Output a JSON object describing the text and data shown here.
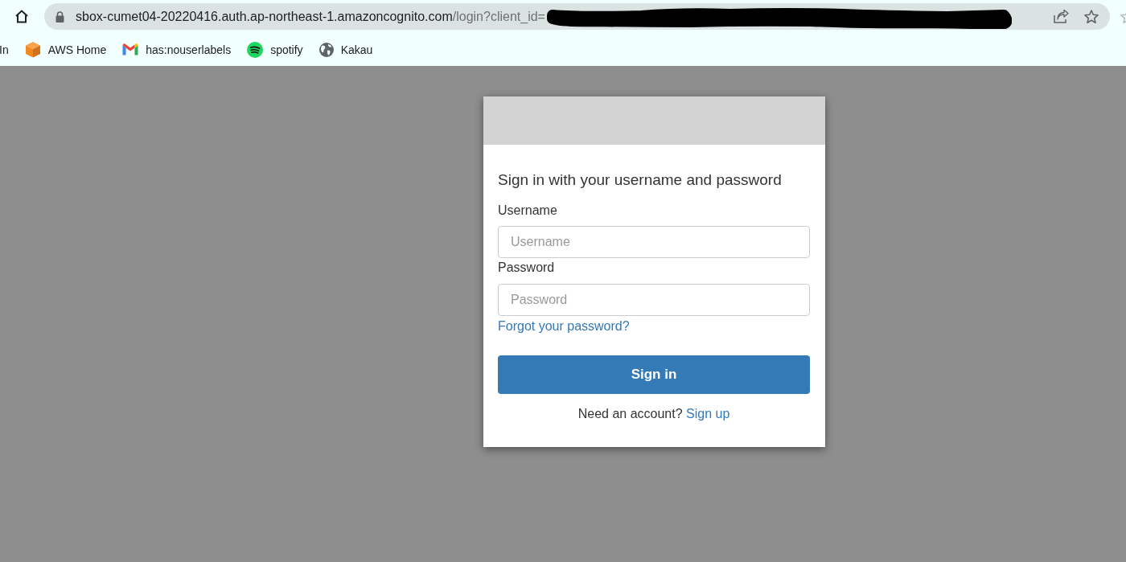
{
  "browser": {
    "address_bar": {
      "host": "sbox-cumet04-20220416.auth.ap-northeast-1.amazoncognito.com",
      "path": "/login?client_id="
    },
    "bookmarks": [
      {
        "label": "In",
        "kind": "plain"
      },
      {
        "label": "AWS Home",
        "kind": "cube"
      },
      {
        "label": "has:nouserlabels",
        "kind": "mail"
      },
      {
        "label": "spotify",
        "kind": "music"
      },
      {
        "label": "Kakau",
        "kind": "globe"
      }
    ]
  },
  "login_card": {
    "title": "Sign in with your username and password",
    "fields": [
      {
        "label": "Username",
        "placeholder": "Username"
      },
      {
        "label": "Password",
        "placeholder": "Password"
      }
    ],
    "forgot_link": "Forgot your password?",
    "submit_button": "Sign in",
    "signup_prompt": "Need an account?",
    "signup_link": "Sign up"
  }
}
